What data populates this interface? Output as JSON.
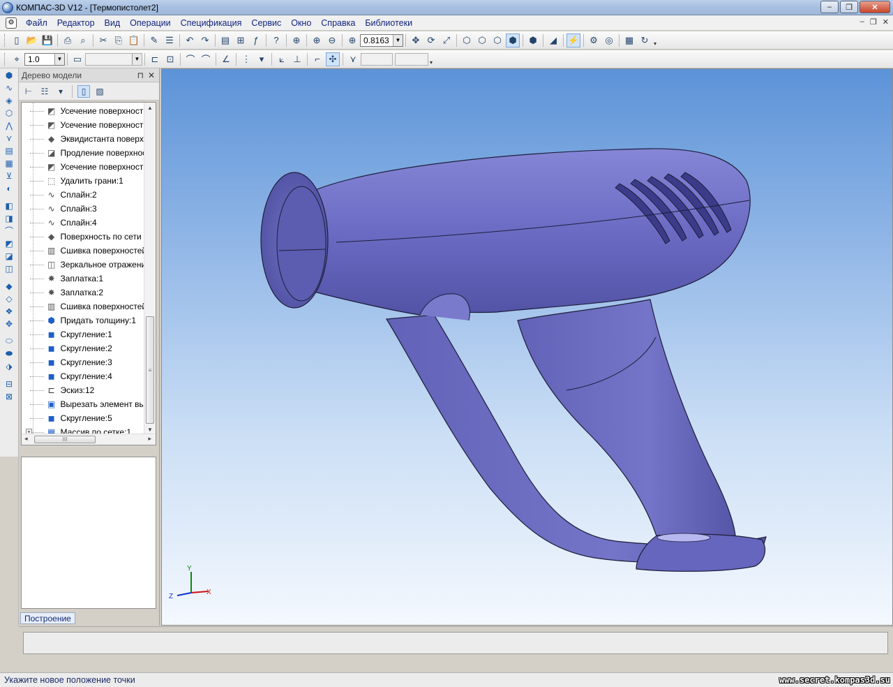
{
  "window": {
    "title": "КОМПАС-3D V12 - [Термопистолет2]",
    "minimize_glyph": "–",
    "maximize_glyph": "❐",
    "close_glyph": "✕"
  },
  "menu": {
    "items": [
      "Файл",
      "Редактор",
      "Вид",
      "Операции",
      "Спецификация",
      "Сервис",
      "Окно",
      "Справка",
      "Библиотеки"
    ],
    "mdi_minimize": "–",
    "mdi_restore": "❐",
    "mdi_close": "✕"
  },
  "toolbar_main": {
    "zoom_value": "0.8163"
  },
  "toolbar_secondary": {
    "step_value": "1.0"
  },
  "tree": {
    "title": "Дерево модели",
    "pin_glyph": "⊓",
    "close_glyph": "✕",
    "items": [
      {
        "label": "Усечение поверхности",
        "icon": "trim-surface-icon"
      },
      {
        "label": "Усечение поверхности",
        "icon": "trim-surface-icon"
      },
      {
        "label": "Эквидистанта поверхн",
        "icon": "offset-surface-icon"
      },
      {
        "label": "Продление поверхнос",
        "icon": "extend-surface-icon"
      },
      {
        "label": "Усечение поверхности",
        "icon": "trim-surface-icon"
      },
      {
        "label": "Удалить грани:1",
        "icon": "delete-faces-icon"
      },
      {
        "label": "Сплайн:2",
        "icon": "spline-icon"
      },
      {
        "label": "Сплайн:3",
        "icon": "spline-icon"
      },
      {
        "label": "Сплайн:4",
        "icon": "spline-icon"
      },
      {
        "label": "Поверхность по сети т",
        "icon": "net-surface-icon"
      },
      {
        "label": "Сшивка поверхностей",
        "icon": "sew-surfaces-icon"
      },
      {
        "label": "Зеркальное отражени",
        "icon": "mirror-icon"
      },
      {
        "label": "Заплатка:1",
        "icon": "patch-icon"
      },
      {
        "label": "Заплатка:2",
        "icon": "patch-icon"
      },
      {
        "label": "Сшивка поверхностей",
        "icon": "sew-surfaces-icon"
      },
      {
        "label": "Придать толщину:1",
        "icon": "thicken-icon"
      },
      {
        "label": "Скругление:1",
        "icon": "fillet-icon"
      },
      {
        "label": "Скругление:2",
        "icon": "fillet-icon"
      },
      {
        "label": "Скругление:3",
        "icon": "fillet-icon"
      },
      {
        "label": "Скругление:4",
        "icon": "fillet-icon"
      },
      {
        "label": "Эскиз:12",
        "icon": "sketch-icon"
      },
      {
        "label": "Вырезать элемент вы",
        "icon": "cut-extrude-icon"
      },
      {
        "label": "Скругление:5",
        "icon": "fillet-icon"
      },
      {
        "label": "Массив по сетке:1",
        "icon": "grid-pattern-icon"
      }
    ],
    "tab_label": "Построение",
    "hscroll_grip": "III",
    "vscroll_grip": "≡"
  },
  "viewport": {
    "model_color": "#6b6bc4",
    "axes": {
      "x": "X",
      "y": "Y",
      "z": "Z"
    }
  },
  "status": {
    "prompt": "Укажите новое положение точки",
    "watermark": "www.secret.kompas3d.su"
  },
  "colors": {
    "menu_text": "#10247e",
    "model_fill": "#6b6bc4",
    "model_edge": "#1d1d3a",
    "viewport_top": "#5c93d8",
    "viewport_bottom": "#f4f8fe"
  }
}
